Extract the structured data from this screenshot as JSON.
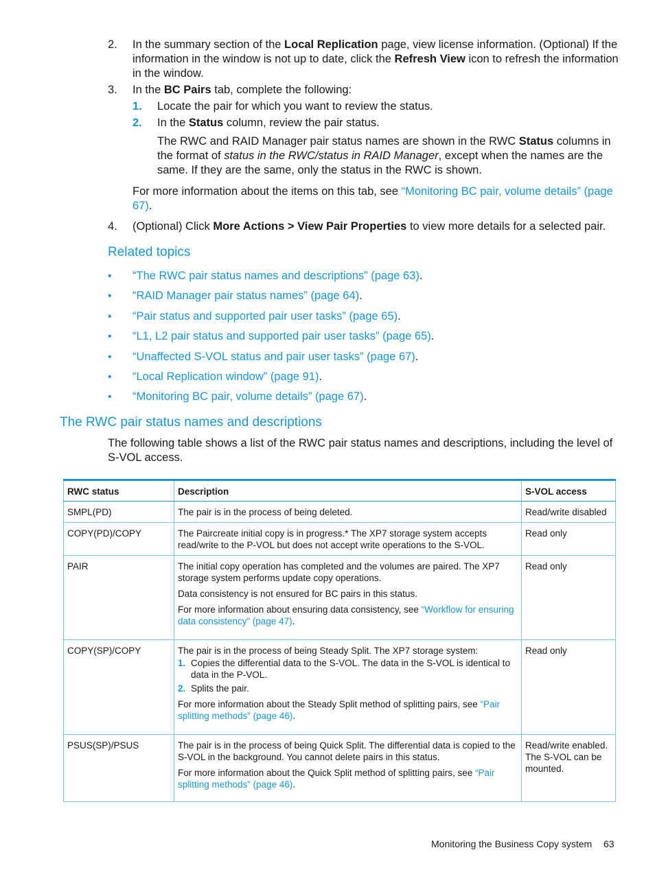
{
  "steps": {
    "step2": {
      "num": "2.",
      "t1": "In the summary section of the ",
      "b1": "Local Replication",
      "t2": " page, view license information. (Optional) If the information in the window is not up to date, click the ",
      "b2": "Refresh View",
      "t3": " icon to refresh the information in the window."
    },
    "step3": {
      "num": "3.",
      "t1": "In the ",
      "b1": "BC Pairs",
      "t2": " tab, complete the following:",
      "sub1": {
        "num": "1.",
        "text": "Locate the pair for which you want to review the status."
      },
      "sub2": {
        "num": "2.",
        "t1": "In the ",
        "b1": "Status",
        "t2": " column, review the pair status."
      },
      "note": {
        "t1": "The RWC and RAID Manager pair status names are shown in the RWC ",
        "b1": "Status",
        "t2": " columns in the format of ",
        "i1": "status in the RWC/status in RAID Manager",
        "t3": ", except when the names are the same. If they are the same, only the status in the RWC is shown."
      },
      "more": {
        "t1": "For more information about the items on this tab, see ",
        "link": "“Monitoring BC pair, volume details” (page 67)",
        "t2": "."
      }
    },
    "step4": {
      "num": "4.",
      "t1": "(Optional) Click ",
      "b1": "More Actions > View Pair Properties",
      "t2": " to view more details for a selected pair."
    }
  },
  "related": {
    "title": "Related topics",
    "bullet": "•",
    "items": [
      "“The RWC pair status names and descriptions” (page 63)",
      "“RAID Manager pair status names” (page 64)",
      "“Pair status and supported pair user tasks” (page 65)",
      "“L1, L2 pair status and supported pair user tasks” (page 65)",
      "“Unaffected S-VOL status and pair user tasks” (page 67)",
      "“Local Replication window” (page 91)",
      "“Monitoring BC pair, volume details” (page 67)"
    ],
    "period": "."
  },
  "section": {
    "title": "The RWC pair status names and descriptions",
    "intro": "The following table shows a list of the RWC pair status names and descriptions, including the level of S-VOL access."
  },
  "table": {
    "headers": [
      "RWC status",
      "Description",
      "S-VOL access"
    ],
    "rows": [
      {
        "status": "SMPL(PD)",
        "desc1": "The pair is in the process of being deleted.",
        "access": "Read/write disabled"
      },
      {
        "status": "COPY(PD)/COPY",
        "desc1": "The Paircreate initial copy is in progress.* The XP7 storage system accepts read/write to the P-VOL but does not accept write operations to the S-VOL.",
        "access": "Read only"
      },
      {
        "status": "PAIR",
        "desc1": "The initial copy operation has completed and the volumes are paired. The XP7 storage system performs update copy operations.",
        "desc2": "Data consistency is not ensured for BC pairs in this status.",
        "more_t": "For more information about ensuring data consistency, see ",
        "more_link": "“Workflow for ensuring data consistency” (page 47)",
        "access": "Read only"
      },
      {
        "status": "COPY(SP)/COPY",
        "desc1": "The pair is in the process of being Steady Split. The XP7 storage system:",
        "sub1_num": "1.",
        "sub1": "Copies the differential data to the S-VOL. The data in the S-VOL is identical to data in the P-VOL.",
        "sub2_num": "2.",
        "sub2": "Splits the pair.",
        "more_t": "For more information about the Steady Split method of splitting pairs, see ",
        "more_link": "“Pair splitting methods” (page 46)",
        "access": "Read only"
      },
      {
        "status": "PSUS(SP)/PSUS",
        "desc1": "The pair is in the process of being Quick Split. The differential data is copied to the S-VOL in the background. You cannot delete pairs in this status.",
        "more_t": "For more information about the Quick Split method of splitting pairs, see ",
        "more_link": "“Pair splitting methods” (page 46)",
        "access": "Read/write enabled. The S-VOL can be mounted."
      }
    ],
    "period": "."
  },
  "footer": {
    "title": "Monitoring the Business Copy system",
    "page": "63"
  }
}
